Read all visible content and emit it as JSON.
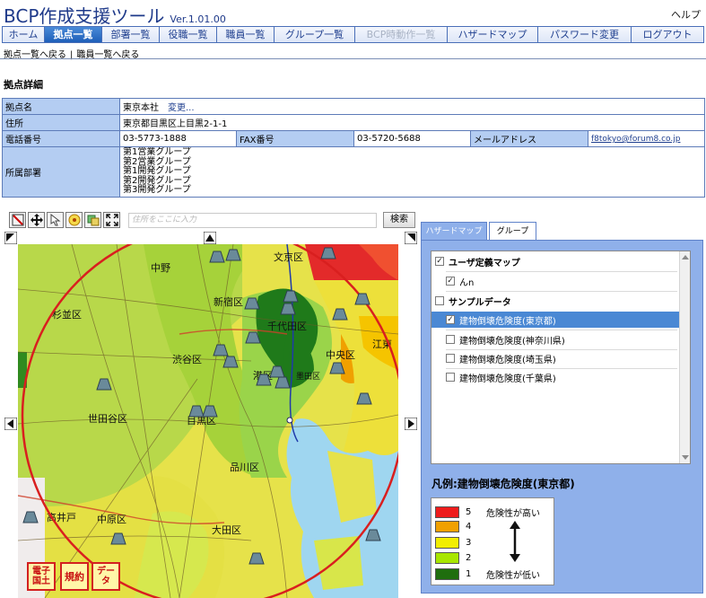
{
  "header": {
    "title": "BCP作成支援ツール",
    "version": "Ver.1.01.00",
    "help": "ヘルプ"
  },
  "nav": {
    "tabs": [
      {
        "label": "ホーム",
        "state": "normal"
      },
      {
        "label": "拠点一覧",
        "state": "active"
      },
      {
        "label": "部署一覧",
        "state": "normal"
      },
      {
        "label": "役職一覧",
        "state": "normal"
      },
      {
        "label": "職員一覧",
        "state": "normal"
      },
      {
        "label": "グループ一覧",
        "state": "normal"
      },
      {
        "label": "BCP時動作一覧",
        "state": "disabled"
      },
      {
        "label": "ハザードマップ",
        "state": "normal"
      },
      {
        "label": "パスワード変更",
        "state": "normal"
      },
      {
        "label": "ログアウト",
        "state": "normal"
      }
    ]
  },
  "subnav": {
    "back_sites": "拠点一覧へ戻る",
    "separator": "|",
    "back_staff": "職員一覧へ戻る"
  },
  "section_title": "拠点詳細",
  "details": {
    "name_label": "拠点名",
    "name_value": "東京本社",
    "change_link": "変更...",
    "address_label": "住所",
    "address_value": "東京都目黒区上目黒2-1-1",
    "tel_label": "電話番号",
    "tel_value": "03-5773-1888",
    "fax_label": "FAX番号",
    "fax_value": "03-5720-5688",
    "mail_label": "メールアドレス",
    "mail_value": "f8tokyo@forum8.co.jp",
    "dept_label": "所属部署",
    "departments": [
      "第1営業グループ",
      "第2営業グループ",
      "第1開発グループ",
      "第2開発グループ",
      "第3開発グループ"
    ]
  },
  "map_toolbar": {
    "search_placeholder": "住所をここに入力",
    "search_button": "検索"
  },
  "map": {
    "labels": {
      "nakano": "中野",
      "bunkyo": "文京区",
      "suginami": "杉並区",
      "shinjuku": "新宿区",
      "chiyoda": "千代田区",
      "shibuya": "渋谷区",
      "chuo": "中央区",
      "koto": "江東",
      "minato": "港区",
      "setagaya": "世田谷区",
      "meguro": "目黒区",
      "shinagawa": "品川区",
      "takaido": "高井戸",
      "nakahara": "中原区",
      "ota": "大田区",
      "sumida": "墨田区"
    },
    "badges": {
      "denshi": "電子国土",
      "kiyaku": "規約",
      "data": "データ"
    }
  },
  "panel": {
    "tab_hazard": "ハザードマップ",
    "tab_group": "グループ",
    "layers": [
      {
        "label": "ユーザ定義マップ",
        "checked": true,
        "level": 0,
        "bold": true
      },
      {
        "label": "んn",
        "checked": true,
        "level": 1,
        "bold": false
      },
      {
        "label": "サンプルデータ",
        "checked": false,
        "level": 0,
        "bold": true
      },
      {
        "label": "建物倒壊危険度(東京都)",
        "checked": true,
        "level": 1,
        "bold": false,
        "selected": true
      },
      {
        "label": "建物倒壊危険度(神奈川県)",
        "checked": false,
        "level": 1,
        "bold": false
      },
      {
        "label": "建物倒壊危険度(埼玉県)",
        "checked": false,
        "level": 1,
        "bold": false
      },
      {
        "label": "建物倒壊危険度(千葉県)",
        "checked": false,
        "level": 1,
        "bold": false
      }
    ]
  },
  "legend": {
    "title": "凡例:建物倒壊危険度(東京都)",
    "high_label": "危険性が高い",
    "low_label": "危険性が低い",
    "levels": [
      {
        "value": "5",
        "color": "#ee1c1c"
      },
      {
        "value": "4",
        "color": "#f0a000"
      },
      {
        "value": "3",
        "color": "#f2ee00"
      },
      {
        "value": "2",
        "color": "#a8e600"
      },
      {
        "value": "1",
        "color": "#1f6e0e"
      }
    ]
  },
  "colors": {
    "accent": "#1e5fb9",
    "label_cell": "#b4cdf2",
    "panel": "#8fb0ea",
    "selected_row": "#4a88d4",
    "radius_circle": "#d91f1f"
  }
}
